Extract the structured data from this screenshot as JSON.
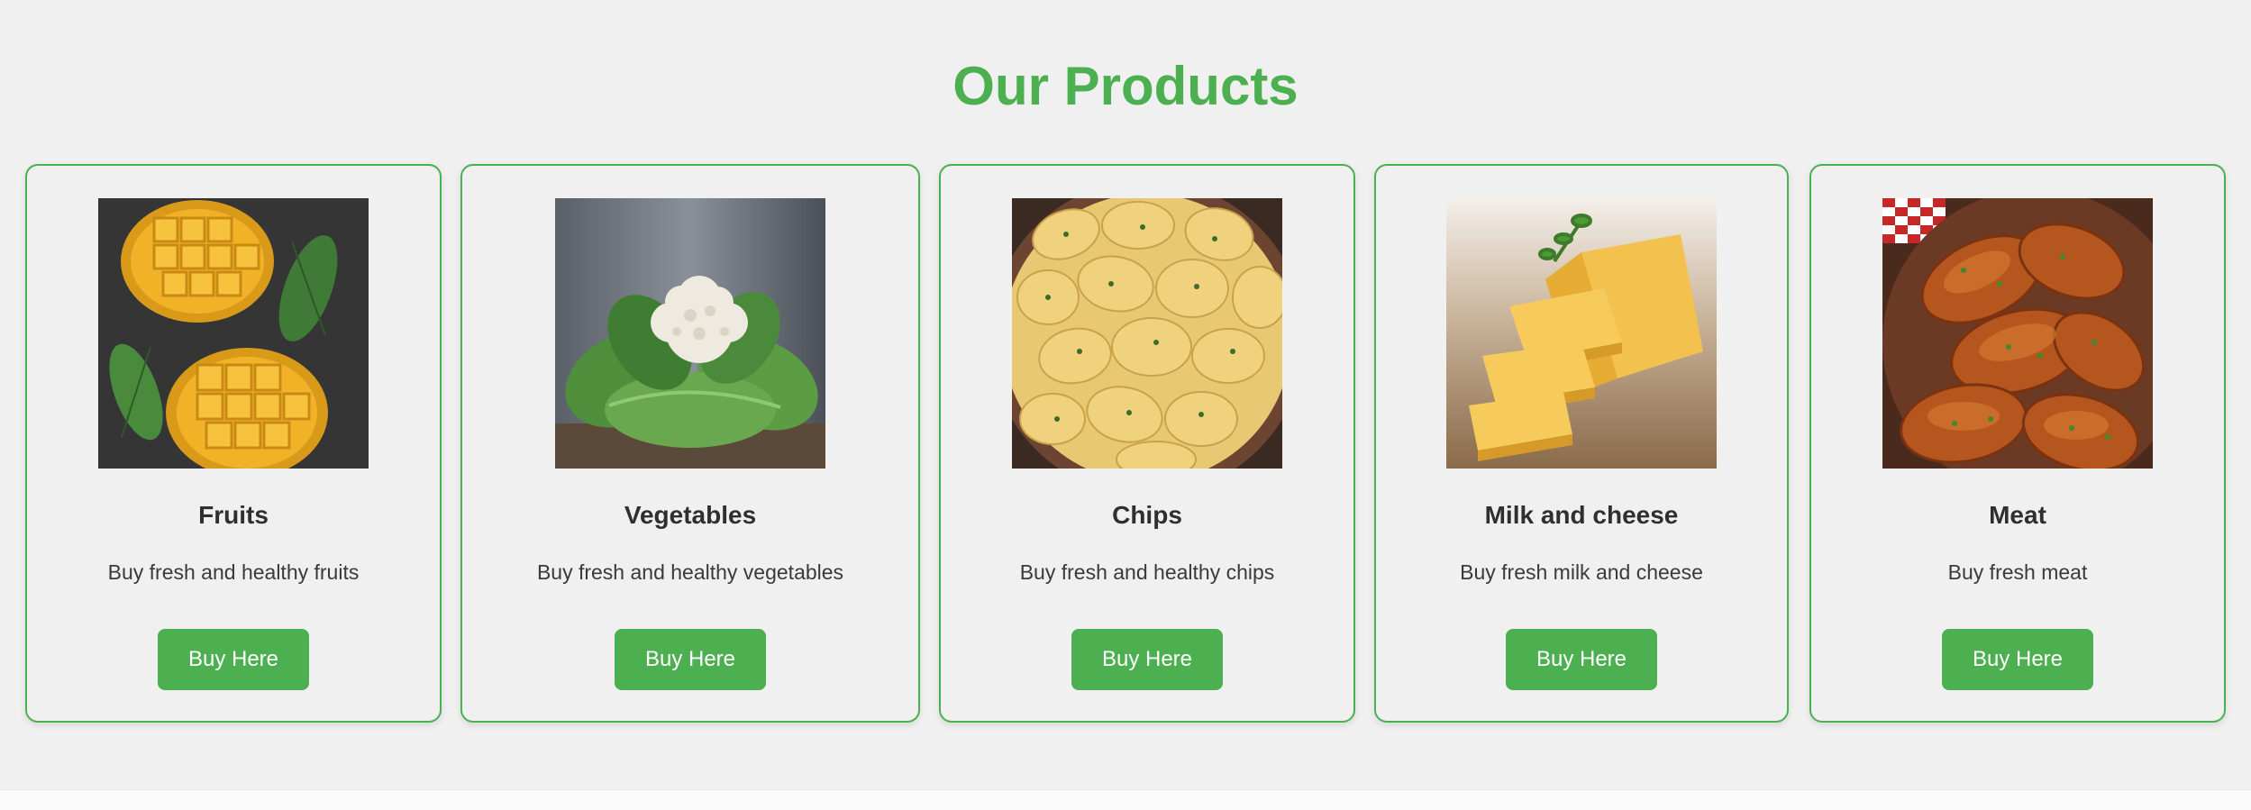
{
  "section": {
    "title": "Our Products"
  },
  "colors": {
    "accent": "#4caf50",
    "background": "#f0f0f0",
    "text": "#2f2f2f"
  },
  "products": [
    {
      "name": "Fruits",
      "description": "Buy fresh and healthy fruits",
      "button_label": "Buy Here",
      "image": "mango-photo"
    },
    {
      "name": "Vegetables",
      "description": "Buy fresh and healthy vegetables",
      "button_label": "Buy Here",
      "image": "cauliflower-photo"
    },
    {
      "name": "Chips",
      "description": "Buy fresh and healthy chips",
      "button_label": "Buy Here",
      "image": "potato-chips-photo"
    },
    {
      "name": "Milk and cheese",
      "description": "Buy fresh milk and cheese",
      "button_label": "Buy Here",
      "image": "cheese-photo"
    },
    {
      "name": "Meat",
      "description": "Buy fresh meat",
      "button_label": "Buy Here",
      "image": "chicken-drumsticks-photo"
    }
  ]
}
